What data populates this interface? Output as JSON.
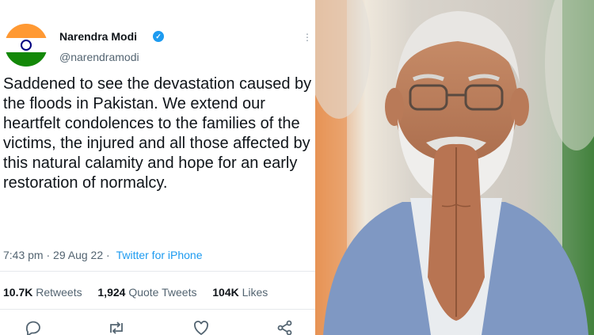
{
  "tweet": {
    "author_name": "Narendra Modi",
    "handle": "@narendramodi",
    "text": "Saddened to see the devastation caused by the floods in Pakistan. We extend our heartfelt condolences to the families of the victims, the injured and all those affected by this natural calamity and hope for an early restoration of normalcy.",
    "time": "7:43 pm",
    "separator": "·",
    "date": "29 Aug 22",
    "source": "Twitter for iPhone",
    "stats": {
      "retweets_count": "10.7K",
      "retweets_label": "Retweets",
      "quotes_count": "1,924",
      "quotes_label": "Quote Tweets",
      "likes_count": "104K",
      "likes_label": "Likes"
    },
    "icons": [
      "reply-icon",
      "retweet-icon",
      "like-icon",
      "share-icon",
      "more-icon",
      "verified-badge-icon"
    ]
  },
  "colors": {
    "text": "#0f1419",
    "secondary": "#536471",
    "link": "#1d9bf0",
    "verified": "#1d9bf0",
    "saffron": "#ff9933",
    "green": "#138808",
    "navy": "#000080"
  }
}
